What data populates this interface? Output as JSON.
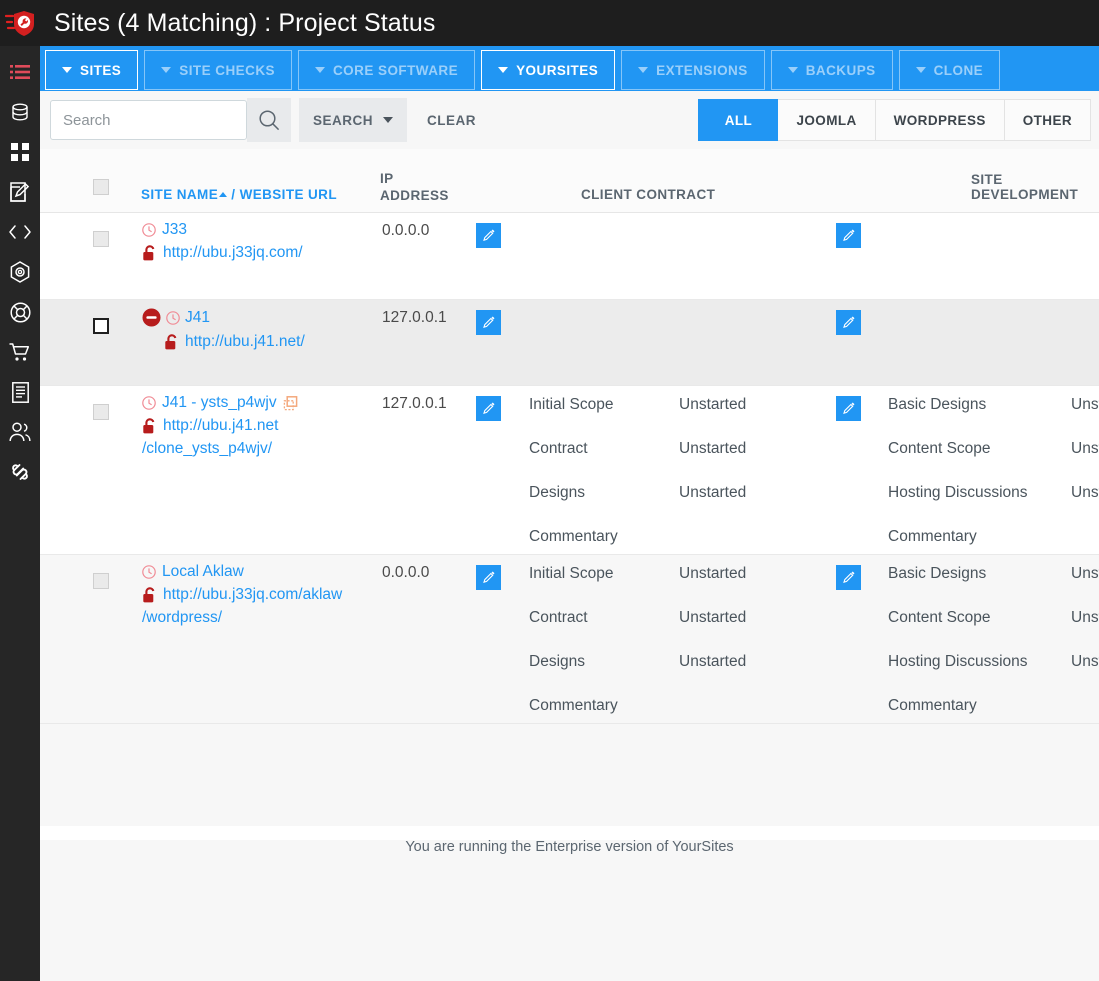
{
  "app": {
    "logo_icon": "shield-wrench-logo",
    "title": "Sites (4 Matching) : Project Status",
    "accent": "#2196f3",
    "rail_bg": "#262626",
    "topbar_bg": "#1e1e1e",
    "danger": "#b71c1c"
  },
  "rail": {
    "items": [
      {
        "icon": "menu-list-icon",
        "name": "sidebar-item-menu",
        "active": true
      },
      {
        "icon": "database-icon",
        "name": "sidebar-item-database",
        "active": false
      },
      {
        "icon": "grid-apps-icon",
        "name": "sidebar-item-apps",
        "active": false
      },
      {
        "icon": "edit-square-icon",
        "name": "sidebar-item-edit",
        "active": false
      },
      {
        "icon": "code-brackets-icon",
        "name": "sidebar-item-code",
        "active": false
      },
      {
        "icon": "hexagon-gear-icon",
        "name": "sidebar-item-config",
        "active": false
      },
      {
        "icon": "life-ring-icon",
        "name": "sidebar-item-support",
        "active": false
      },
      {
        "icon": "shopping-cart-icon",
        "name": "sidebar-item-store",
        "active": false
      },
      {
        "icon": "document-icon",
        "name": "sidebar-item-articles",
        "active": false
      },
      {
        "icon": "users-icon",
        "name": "sidebar-item-users",
        "active": false
      },
      {
        "icon": "joomla-logo-icon",
        "name": "sidebar-item-joomla",
        "active": false
      }
    ]
  },
  "tabs": [
    {
      "label": "SITES",
      "active": true
    },
    {
      "label": "SITE CHECKS",
      "active": false
    },
    {
      "label": "CORE SOFTWARE",
      "active": false
    },
    {
      "label": "YOURSITES",
      "active": true
    },
    {
      "label": "EXTENSIONS",
      "active": false
    },
    {
      "label": "BACKUPS",
      "active": false
    },
    {
      "label": "CLONE",
      "active": false
    }
  ],
  "toolbar": {
    "search_value": "",
    "search_placeholder": "Search",
    "search_icon": "magnifier-icon",
    "search_button": "SEARCH",
    "clear_button": "CLEAR",
    "filters": [
      {
        "label": "ALL",
        "active": true
      },
      {
        "label": "JOOMLA",
        "active": false
      },
      {
        "label": "WORDPRESS",
        "active": false
      },
      {
        "label": "OTHER",
        "active": false
      }
    ]
  },
  "table": {
    "headers": {
      "site_name": "SITE NAME",
      "separator": " / ",
      "website_url": "WEBSITE URL",
      "ip_address_line1": "IP",
      "ip_address_line2": "ADDRESS",
      "client_contract": "CLIENT CONTRACT",
      "site_development": "SITE DEVELOPMENT"
    },
    "rows": [
      {
        "name": "J33",
        "url": "http://ubu.j33jq.com/",
        "url_line2": "",
        "ip": "0.0.0.0",
        "blocked": false,
        "clone": false,
        "checkbox_style": "grey",
        "row_style": "white",
        "contract": [],
        "development": []
      },
      {
        "name": "J41",
        "url": "http://ubu.j41.net/",
        "url_line2": "",
        "ip": "127.0.0.1",
        "blocked": true,
        "clone": false,
        "checkbox_style": "dark",
        "row_style": "alt",
        "contract": [],
        "development": []
      },
      {
        "name": "J41 - ysts_p4wjv",
        "url": "http://ubu.j41.net",
        "url_line2": "/clone_ysts_p4wjv/",
        "ip": "127.0.0.1",
        "blocked": false,
        "clone": true,
        "checkbox_style": "grey",
        "row_style": "white",
        "contract": [
          {
            "label": "Initial Scope",
            "value": "Unstarted"
          },
          {
            "label": "Contract",
            "value": "Unstarted"
          },
          {
            "label": "Designs",
            "value": "Unstarted"
          },
          {
            "label": "Commentary",
            "value": ""
          }
        ],
        "development": [
          {
            "label": "Basic Designs",
            "value": "Unstarted"
          },
          {
            "label": "Content Scope",
            "value": "Unstarted"
          },
          {
            "label": "Hosting Discussions",
            "value": "Unstarted"
          },
          {
            "label": "Commentary",
            "value": ""
          }
        ]
      },
      {
        "name": "Local Aklaw",
        "url": "http://ubu.j33jq.com/aklaw",
        "url_line2": "/wordpress/",
        "ip": "0.0.0.0",
        "blocked": false,
        "clone": false,
        "checkbox_style": "grey",
        "row_style": "soft",
        "contract": [
          {
            "label": "Initial Scope",
            "value": "Unstarted"
          },
          {
            "label": "Contract",
            "value": "Unstarted"
          },
          {
            "label": "Designs",
            "value": "Unstarted"
          },
          {
            "label": "Commentary",
            "value": ""
          }
        ],
        "development": [
          {
            "label": "Basic Designs",
            "value": "Unstarted"
          },
          {
            "label": "Content Scope",
            "value": "Unstarted"
          },
          {
            "label": "Hosting Discussions",
            "value": "Unstarted"
          },
          {
            "label": "Commentary",
            "value": ""
          }
        ]
      }
    ]
  },
  "footer": {
    "note": "You are running the Enterprise version of YourSites"
  }
}
